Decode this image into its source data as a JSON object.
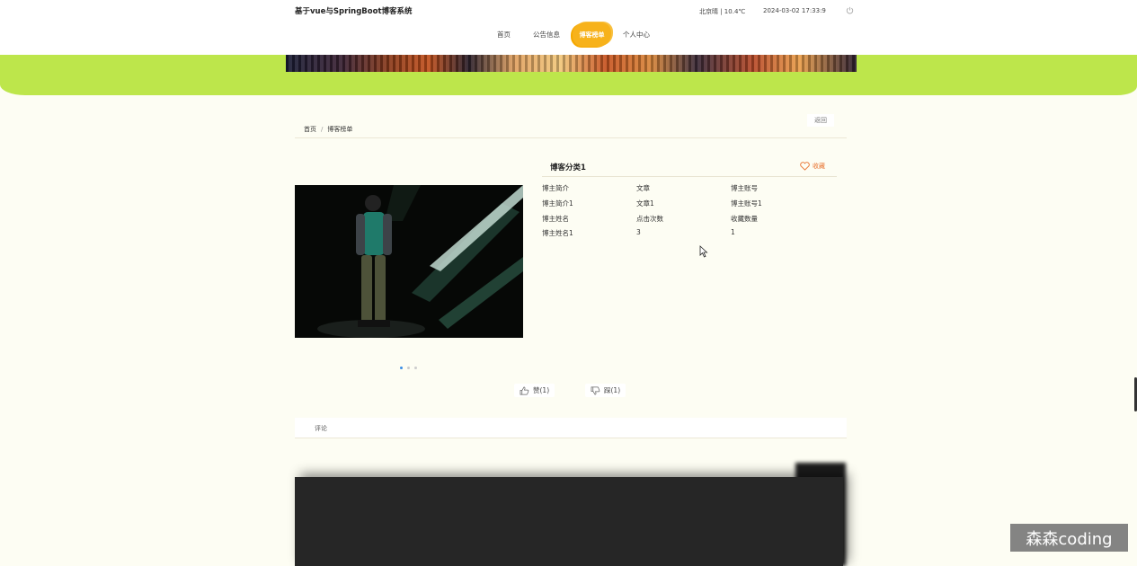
{
  "header": {
    "site_title": "基于vue与SpringBoot博客系统",
    "weather": "北京晴 | 10.4℃",
    "datetime": "2024-03-02  17:33:9"
  },
  "nav": {
    "items": [
      {
        "label": "首页"
      },
      {
        "label": "公告信息"
      },
      {
        "label": "博客榜单"
      },
      {
        "label": "个人中心"
      }
    ]
  },
  "breadcrumb": {
    "home": "首页",
    "separator": "/",
    "current": "博客榜单",
    "back_label": "返回"
  },
  "detail": {
    "title": "博客分类1",
    "favorite_label": "收藏",
    "fields": [
      {
        "label": "博主简介",
        "value": "博主简介1"
      },
      {
        "label": "文章",
        "value": "文章1"
      },
      {
        "label": "博主账号",
        "value": "博主账号1"
      },
      {
        "label": "博主姓名",
        "value": "博主姓名1"
      },
      {
        "label": "点击次数",
        "value": "3"
      },
      {
        "label": "收藏数量",
        "value": "1"
      }
    ],
    "carousel": {
      "count": 3,
      "active_index": 0
    }
  },
  "votes": {
    "like_label": "赞(1)",
    "dislike_label": "踩(1)"
  },
  "comments": {
    "tab_label": "评论"
  },
  "watermark": "森森coding",
  "colors": {
    "accent_orange": "#f7b21b",
    "banner_green": "#bde64b",
    "favorite": "#e8722f",
    "page_bg": "#fdfdf3"
  }
}
